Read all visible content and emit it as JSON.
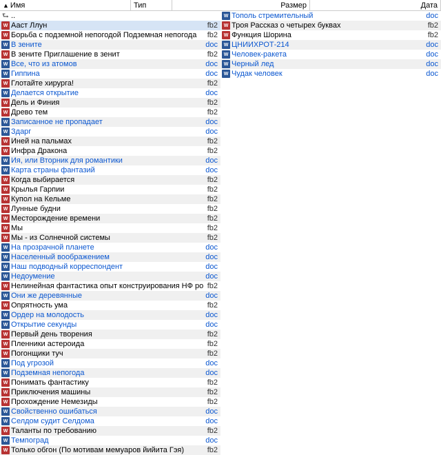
{
  "headers": {
    "name": "Имя",
    "type": "Тип",
    "size": "Размер",
    "date": "Дата"
  },
  "upDir": "..",
  "iconText": {
    "fb2": "W",
    "doc": "W"
  },
  "left": [
    {
      "name": "Ааст Ллун",
      "ext": "fb2",
      "link": false,
      "sel": true
    },
    {
      "name": "Борьба с подземной непогодой Подземная непогода",
      "ext": "fb2",
      "link": false
    },
    {
      "name": "В зените",
      "ext": "doc",
      "link": true
    },
    {
      "name": "В зените Приглашение в зенит",
      "ext": "fb2",
      "link": false
    },
    {
      "name": "Все, что из атомов",
      "ext": "doc",
      "link": true
    },
    {
      "name": "Гиппина",
      "ext": "doc",
      "link": true
    },
    {
      "name": "Глотайте хирурга!",
      "ext": "fb2",
      "link": false
    },
    {
      "name": "Делается открытие",
      "ext": "doc",
      "link": true
    },
    {
      "name": "Дель и Финия",
      "ext": "fb2",
      "link": false
    },
    {
      "name": "Древо тем",
      "ext": "fb2",
      "link": false
    },
    {
      "name": "Записанное не пропадает",
      "ext": "doc",
      "link": true
    },
    {
      "name": "Здарг",
      "ext": "doc",
      "link": true
    },
    {
      "name": "Иней на пальмах",
      "ext": "fb2",
      "link": false
    },
    {
      "name": "Инфра Дракона",
      "ext": "fb2",
      "link": false
    },
    {
      "name": "Ия, или Вторник для романтики",
      "ext": "doc",
      "link": true
    },
    {
      "name": "Карта страны фантазий",
      "ext": "doc",
      "link": true
    },
    {
      "name": "Когда выбирается",
      "ext": "fb2",
      "link": false
    },
    {
      "name": "Крылья Гарпии",
      "ext": "fb2",
      "link": false
    },
    {
      "name": "Купол на Кельме",
      "ext": "fb2",
      "link": false
    },
    {
      "name": "Лунные будни",
      "ext": "fb2",
      "link": false
    },
    {
      "name": "Месторождение времени",
      "ext": "fb2",
      "link": false
    },
    {
      "name": "Мы",
      "ext": "fb2",
      "link": false
    },
    {
      "name": "Мы - из Солнечной системы",
      "ext": "fb2",
      "link": false
    },
    {
      "name": "На прозрачной планете",
      "ext": "doc",
      "link": true
    },
    {
      "name": "Населенный воображением",
      "ext": "doc",
      "link": true
    },
    {
      "name": "Наш подводный корреспондент",
      "ext": "doc",
      "link": true
    },
    {
      "name": "Недоумение",
      "ext": "doc",
      "link": true
    },
    {
      "name": "Нелинейная фантастика опыт конструирования НФ романа",
      "ext": "fb2",
      "link": false
    },
    {
      "name": "Они же деревянные",
      "ext": "doc",
      "link": true
    },
    {
      "name": "Опрятность ума",
      "ext": "fb2",
      "link": false
    },
    {
      "name": "Ордер на молодость",
      "ext": "doc",
      "link": true
    },
    {
      "name": "Открытие секунды",
      "ext": "doc",
      "link": true
    },
    {
      "name": "Первый день творения",
      "ext": "fb2",
      "link": false
    },
    {
      "name": "Пленники астероида",
      "ext": "fb2",
      "link": false
    },
    {
      "name": "Погонщики туч",
      "ext": "fb2",
      "link": false
    },
    {
      "name": "Под угрозой",
      "ext": "doc",
      "link": true
    },
    {
      "name": "Подземная непогода",
      "ext": "doc",
      "link": true
    },
    {
      "name": "Понимать фантастику",
      "ext": "fb2",
      "link": false
    },
    {
      "name": "Приключения машины",
      "ext": "fb2",
      "link": false
    },
    {
      "name": "Прохождение Немезиды",
      "ext": "fb2",
      "link": false
    },
    {
      "name": "Свойственно ошибаться",
      "ext": "doc",
      "link": true
    },
    {
      "name": "Селдом судит Селдома",
      "ext": "doc",
      "link": true
    },
    {
      "name": "Таланты по требованию",
      "ext": "fb2",
      "link": false
    },
    {
      "name": "Темпоград",
      "ext": "doc",
      "link": true
    },
    {
      "name": "Только обгон (По мотивам мемуаров йийита Гэя)",
      "ext": "fb2",
      "link": false
    }
  ],
  "right": [
    {
      "name": "Тополь стремительный",
      "ext": "doc",
      "link": true
    },
    {
      "name": "Троя Рассказ о четырех буквах",
      "ext": "fb2",
      "link": false
    },
    {
      "name": "Функция Шорина",
      "ext": "fb2",
      "link": false
    },
    {
      "name": "ЦНИИХРОТ-214",
      "ext": "doc",
      "link": true
    },
    {
      "name": "Человек-ракета",
      "ext": "doc",
      "link": true
    },
    {
      "name": "Черный лед",
      "ext": "doc",
      "link": true
    },
    {
      "name": "Чудак человек",
      "ext": "doc",
      "link": true
    }
  ]
}
